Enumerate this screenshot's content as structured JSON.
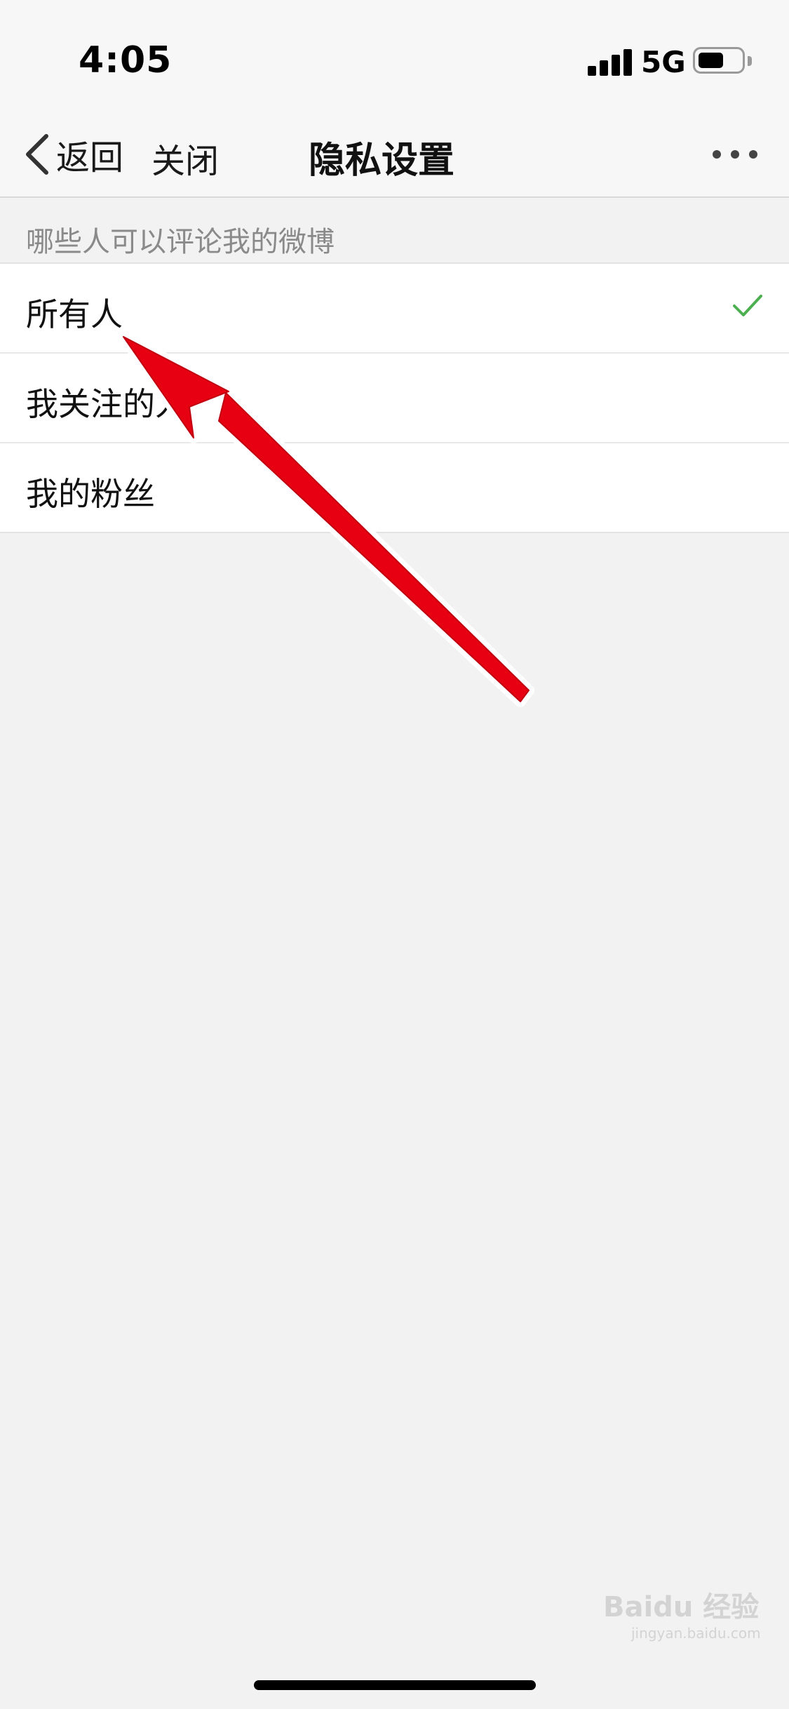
{
  "status_bar": {
    "time": "4:05",
    "network": "5G",
    "battery_level": 0.6
  },
  "nav": {
    "back_label": "返回",
    "close_label": "关闭",
    "title": "隐私设置",
    "more_icon": "more-dots-icon",
    "back_icon": "chevron-left-icon"
  },
  "section": {
    "header": "哪些人可以评论我的微博"
  },
  "options": [
    {
      "label": "所有人",
      "selected": true
    },
    {
      "label": "我关注的人",
      "selected": false
    },
    {
      "label": "我的粉丝",
      "selected": false
    }
  ],
  "watermark": {
    "brand": "Baidu 经验",
    "site": "jingyan.baidu.com"
  },
  "colors": {
    "check": "#4caf50",
    "annotation_arrow": "#e60012",
    "background": "#f2f2f2",
    "section_text": "#8a8a8a"
  }
}
